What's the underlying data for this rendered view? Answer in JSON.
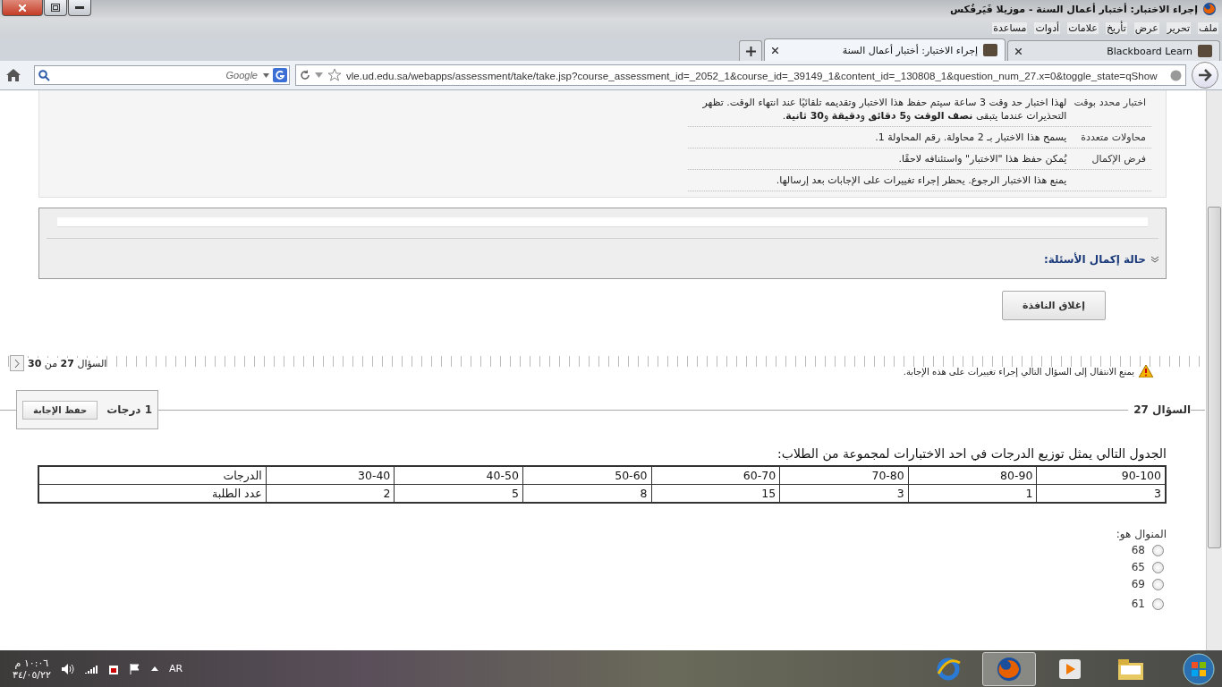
{
  "window": {
    "title": "إجراء الاختبار: أختبار أعمال السنة - موزيلا فَيَرفُكس"
  },
  "menu": [
    "ملف",
    "تحرير",
    "عرض",
    "تأريخ",
    "علامات",
    "أدوات",
    "مساعدة"
  ],
  "tabs": [
    {
      "label": "Blackboard Learn",
      "selected": false
    },
    {
      "label": "إجراء الاختبار: أختبار أعمال السنة",
      "selected": true
    }
  ],
  "address_bar": {
    "url": "vle.ud.edu.sa/webapps/assessment/take/take.jsp?course_assessment_id=_2052_1&course_id=_39149_1&content_id=_130808_1&question_num_27.x=0&toggle_state=qShow"
  },
  "search_field": {
    "placeholder": "Google"
  },
  "test_info": [
    {
      "label": "اختبار محدد بوقت",
      "text": "لهذا اختبار حد وقت 3 ساعة سيتم حفظ هذا الاختبار وتقديمه تلقائيًا عند انتهاء الوقت. تظهر التحذيرات عندما يتبقى **نصف الوقت** و**5 دقائق** و**دقيقة** و**30 ثانية**."
    },
    {
      "label": "محاولات متعددة",
      "text": "يسمح هذا الاختبار بـ 2 محاولة. رقم المحاولة 1."
    },
    {
      "label": "فرض الإكمال",
      "text": "يُمكن حفظ هذا \"الاختبار\" واستئنافه لاحقًا."
    },
    {
      "text": "يمنع هذا الاختبار الرجوع. يحظر إجراء تغييرات على الإجابات بعد إرسالها."
    }
  ],
  "completion_panel": {
    "title": "حالة إكمال الأسئلة:"
  },
  "close_button": "إغلاق النافذة",
  "question_nav": {
    "position": "السؤال **27** من **30**"
  },
  "warning": "يمنع الانتقال إلى السؤال التالي إجراء تغييرات على هذه الإجابة.",
  "question": {
    "title": "السؤال 27",
    "points": "1 درجات",
    "save_button": "حفظ الإجابة",
    "text": "الجدول التالي يمثل توزيع الدرجات في احد الاختبارات  لمجموعة من الطلاب:",
    "table": [
      [
        "90-100",
        "80-90",
        "70-80",
        "60-70",
        "50-60",
        "40-50",
        "30-40",
        "الدرجات"
      ],
      [
        "3",
        "1",
        "3",
        "15",
        "8",
        "5",
        "2",
        "عدد الطلبة"
      ]
    ],
    "prompt": "المنوال هو:",
    "options": [
      {
        "label": "68",
        "selected": false
      },
      {
        "label": "65",
        "selected": false
      },
      {
        "label": "69",
        "selected": false
      },
      {
        "label": "61",
        "selected": false
      }
    ]
  },
  "taskbar": {
    "language": "AR",
    "time": "١٠:٠٦ م",
    "date": "٣٤/٠٥/٢٢"
  }
}
